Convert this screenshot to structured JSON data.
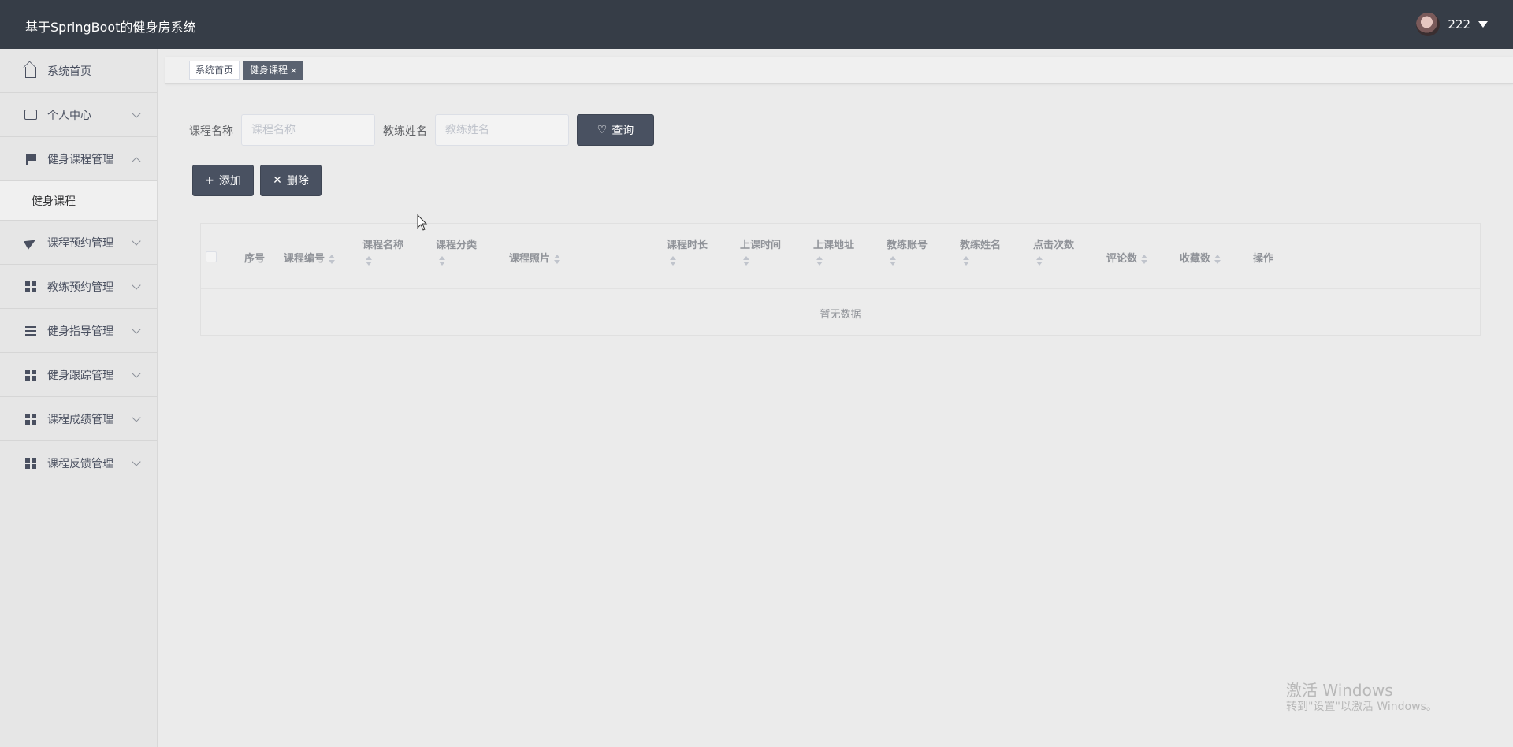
{
  "header": {
    "app_title": "基于SpringBoot的健身房系统",
    "user_name": "222"
  },
  "sidebar": {
    "items": [
      {
        "label": "系统首页",
        "icon": "home-icon"
      },
      {
        "label": "个人中心",
        "icon": "card-icon"
      },
      {
        "label": "健身课程管理",
        "icon": "flag-icon",
        "expanded": true
      },
      {
        "label": "课程预约管理",
        "icon": "send-icon"
      },
      {
        "label": "教练预约管理",
        "icon": "grid-icon"
      },
      {
        "label": "健身指导管理",
        "icon": "list-icon"
      },
      {
        "label": "健身跟踪管理",
        "icon": "grid-icon"
      },
      {
        "label": "课程成绩管理",
        "icon": "grid-icon"
      },
      {
        "label": "课程反馈管理",
        "icon": "grid-icon"
      }
    ],
    "submenu": {
      "label": "健身课程"
    }
  },
  "tags": {
    "home": "系统首页",
    "active": "健身课程",
    "close_glyph": "×"
  },
  "search": {
    "course_name_label": "课程名称",
    "course_name_placeholder": "课程名称",
    "coach_name_label": "教练姓名",
    "coach_name_placeholder": "教练姓名",
    "query_label": "查询"
  },
  "actions": {
    "add_label": "添加",
    "delete_label": "删除"
  },
  "table": {
    "columns": [
      "序号",
      "课程编号",
      "课程名称",
      "课程分类",
      "课程照片",
      "课程时长",
      "上课时间",
      "上课地址",
      "教练账号",
      "教练姓名",
      "点击次数",
      "评论数",
      "收藏数",
      "操作"
    ],
    "empty_text": "暂无数据"
  },
  "watermark": {
    "line1": "激活 Windows",
    "line2": "转到\"设置\"以激活 Windows。"
  },
  "colors": {
    "header_bg": "#363d47",
    "button_bg": "#495161",
    "sidebar_bg": "#e6e6e6",
    "page_bg": "#ebebeb"
  }
}
